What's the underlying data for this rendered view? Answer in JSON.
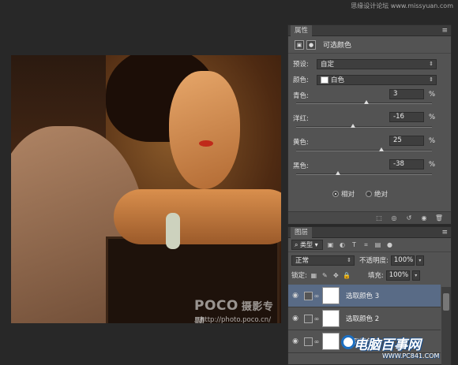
{
  "top_watermark": "思缘设计论坛 www.missyuan.com",
  "photo": {
    "watermark_brand": "POCO",
    "watermark_cn": "摄影专题",
    "watermark_url": "http://photo.poco.cn/"
  },
  "properties": {
    "tab": "属性",
    "title": "可选颜色",
    "preset_label": "预设:",
    "preset_value": "自定",
    "color_label": "颜色:",
    "color_value": "白色",
    "sliders": [
      {
        "label": "青色:",
        "value": "3",
        "unit": "%",
        "level": 0.515
      },
      {
        "label": "洋红:",
        "value": "-16",
        "unit": "%",
        "level": 0.42
      },
      {
        "label": "黄色:",
        "value": "25",
        "unit": "%",
        "level": 0.625
      },
      {
        "label": "黑色:",
        "value": "-38",
        "unit": "%",
        "level": 0.31
      }
    ],
    "method_relative": "相对",
    "method_absolute": "绝对",
    "method_selected": "relative"
  },
  "layers": {
    "tab": "图层",
    "kind_filter": "类型",
    "blend_mode": "正常",
    "opacity_label": "不透明度:",
    "opacity_value": "100%",
    "lock_label": "锁定:",
    "fill_label": "填充:",
    "fill_value": "100%",
    "items": [
      {
        "name": "选取颜色 3",
        "active": true
      },
      {
        "name": "选取颜色 2",
        "active": false
      },
      {
        "name": "选取颜色 1",
        "active": false
      }
    ]
  },
  "logo": {
    "text": "电脑百事网",
    "url": "WWW.PC841.COM"
  },
  "colors": {
    "panel_bg": "#535353",
    "active_layer": "#596b86",
    "workspace": "#282828"
  }
}
